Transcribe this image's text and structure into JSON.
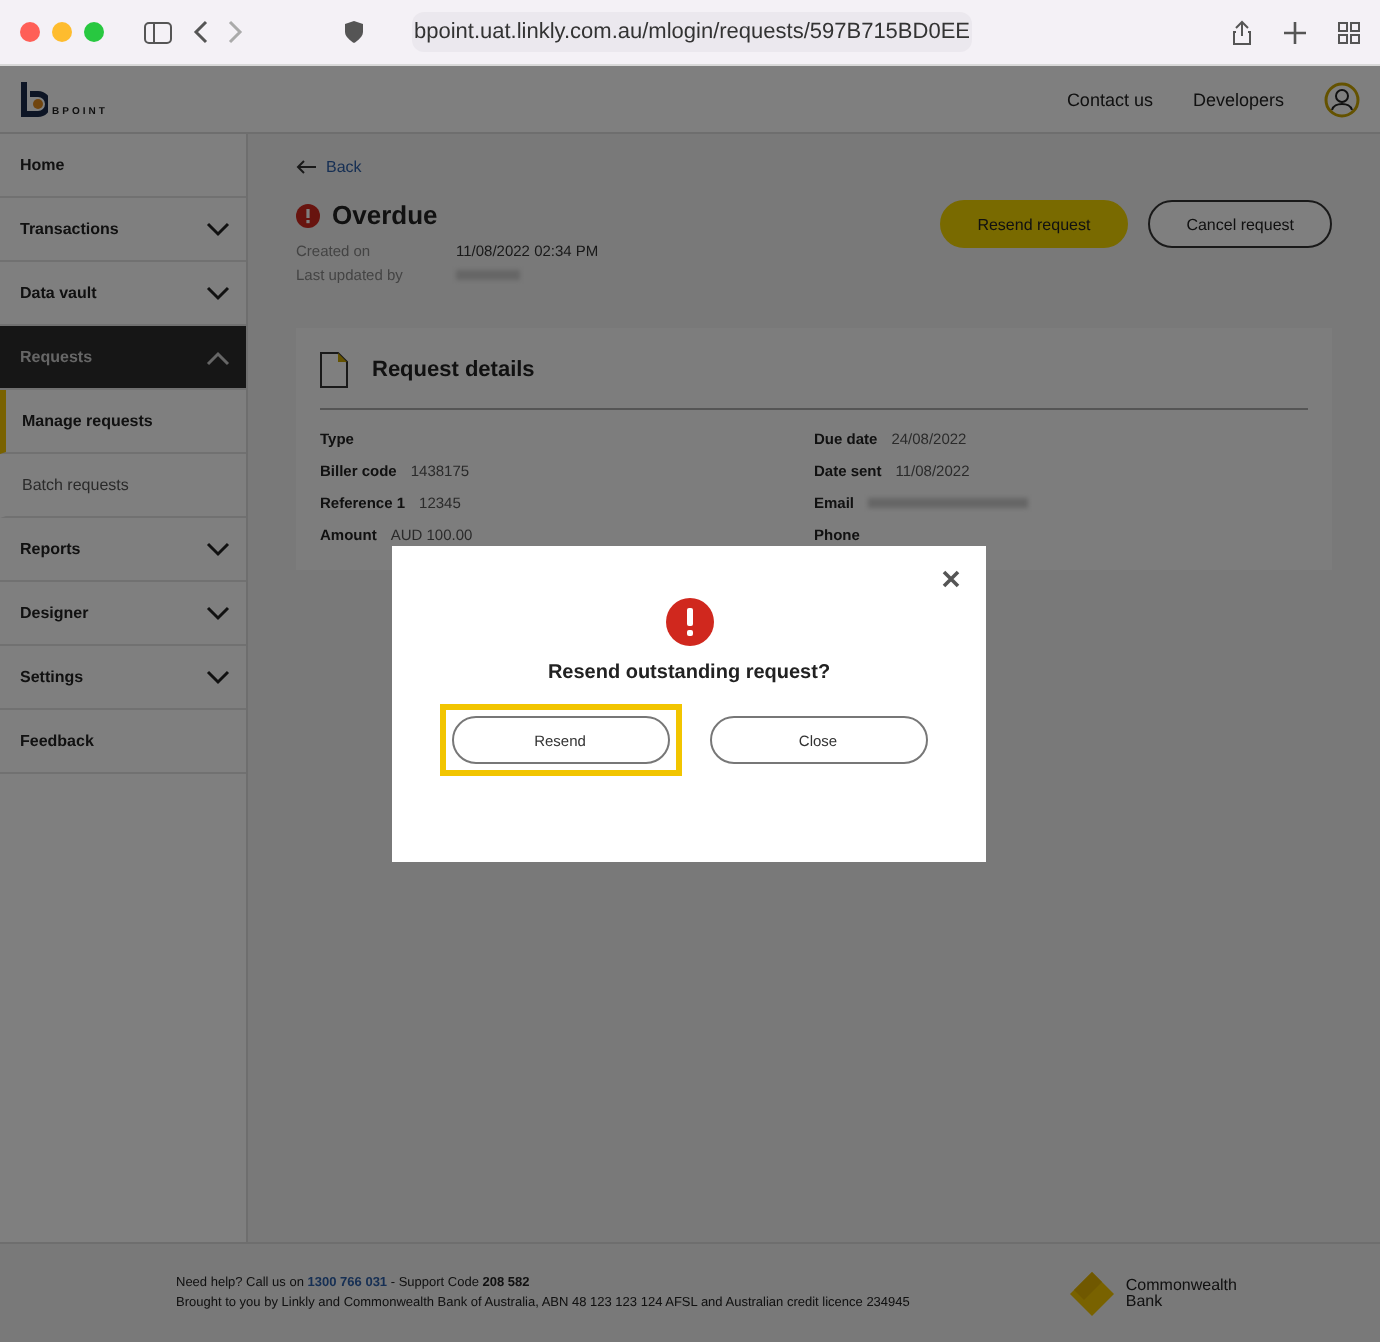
{
  "browser": {
    "url": "bpoint.uat.linkly.com.au/mlogin/requests/597B715BD0EE"
  },
  "header": {
    "logo_text": "BPOINT",
    "links": [
      "Contact us",
      "Developers"
    ]
  },
  "sidebar": {
    "items": [
      {
        "label": "Home",
        "expandable": false,
        "selected": false
      },
      {
        "label": "Transactions",
        "expandable": true,
        "expanded": false,
        "selected": false
      },
      {
        "label": "Data vault",
        "expandable": true,
        "expanded": false,
        "selected": false
      },
      {
        "label": "Requests",
        "expandable": true,
        "expanded": true,
        "selected": true,
        "children": [
          {
            "label": "Manage requests",
            "selected": true
          },
          {
            "label": "Batch requests",
            "selected": false
          }
        ]
      },
      {
        "label": "Reports",
        "expandable": true,
        "expanded": false,
        "selected": false
      },
      {
        "label": "Designer",
        "expandable": true,
        "expanded": false,
        "selected": false
      },
      {
        "label": "Settings",
        "expandable": true,
        "expanded": false,
        "selected": false
      },
      {
        "label": "Feedback",
        "expandable": false,
        "selected": false
      }
    ]
  },
  "page": {
    "back": "Back",
    "status": "Overdue",
    "meta": [
      {
        "label": "Created on",
        "value": "11/08/2022 02:34 PM",
        "redacted": false
      },
      {
        "label": "Last updated by",
        "redacted": true
      }
    ],
    "actions": [
      {
        "label": "Resend request",
        "kind": "primary"
      },
      {
        "label": "Cancel request",
        "kind": "secondary"
      }
    ]
  },
  "details": {
    "title": "Request details",
    "left": [
      {
        "label": "Type"
      },
      {
        "label": "Biller code",
        "value": "1438175"
      },
      {
        "label": "Reference 1",
        "value": "12345"
      },
      {
        "label": "Amount",
        "value": "AUD 100.00"
      }
    ],
    "right": [
      {
        "label": "Due date",
        "value": "24/08/2022"
      },
      {
        "label": "Date sent",
        "value": "11/08/2022"
      },
      {
        "label": "Email",
        "redacted": true
      },
      {
        "label": "Phone"
      }
    ]
  },
  "modal": {
    "title": "Resend outstanding request?",
    "buttons": [
      {
        "label": "Resend",
        "focused": true
      },
      {
        "label": "Close",
        "focused": false
      }
    ]
  },
  "footer": {
    "help": "Need help? Call us on",
    "phone": "1300 766 031",
    "support": "- Support Code",
    "code": "208 582",
    "credit": "Brought to you by Linkly and Commonwealth Bank of Australia, ABN 48 123 123 124 AFSL and Australian credit licence 234945",
    "bank": [
      "Commonwealth",
      "Bank"
    ]
  }
}
